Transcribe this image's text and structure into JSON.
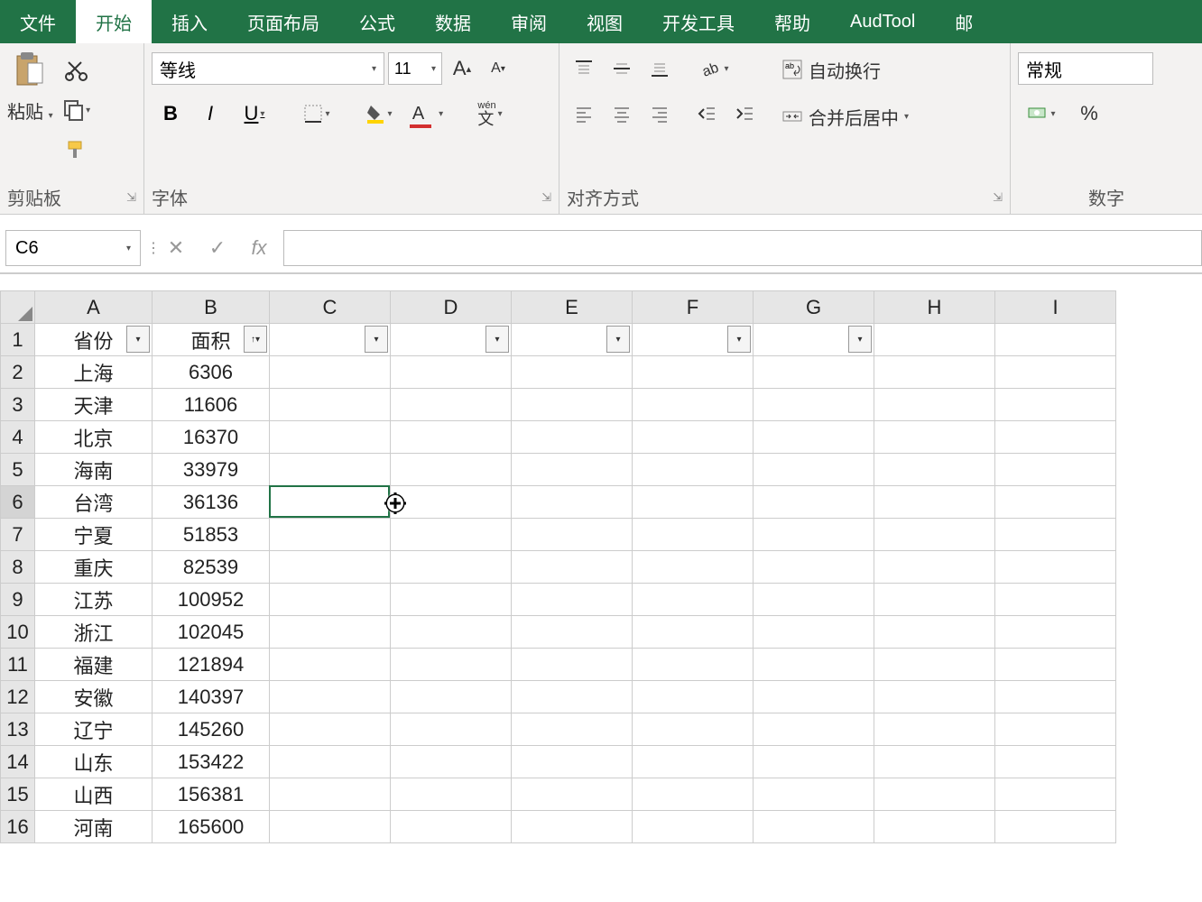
{
  "ribbon": {
    "tabs": [
      "文件",
      "开始",
      "插入",
      "页面布局",
      "公式",
      "数据",
      "审阅",
      "视图",
      "开发工具",
      "帮助",
      "AudTool",
      "邮"
    ],
    "active_tab_index": 1,
    "clipboard": {
      "paste_label": "粘贴",
      "group_label": "剪贴板"
    },
    "font": {
      "name": "等线",
      "size": "11",
      "group_label": "字体"
    },
    "alignment": {
      "wrap_label": "自动换行",
      "merge_label": "合并后居中",
      "group_label": "对齐方式"
    },
    "number": {
      "format": "常规",
      "group_label": "数字"
    }
  },
  "formula_bar": {
    "cell_ref": "C6",
    "fx_label": "fx",
    "formula_value": ""
  },
  "grid": {
    "columns": [
      "A",
      "B",
      "C",
      "D",
      "E",
      "F",
      "G",
      "H",
      "I"
    ],
    "header_row": {
      "A": "省份",
      "B": "面积"
    },
    "rows": [
      {
        "num": 1,
        "A": "省份",
        "B": "面积"
      },
      {
        "num": 2,
        "A": "上海",
        "B": "6306"
      },
      {
        "num": 3,
        "A": "天津",
        "B": "11606"
      },
      {
        "num": 4,
        "A": "北京",
        "B": "16370"
      },
      {
        "num": 5,
        "A": "海南",
        "B": "33979"
      },
      {
        "num": 6,
        "A": "台湾",
        "B": "36136"
      },
      {
        "num": 7,
        "A": "宁夏",
        "B": "51853"
      },
      {
        "num": 8,
        "A": "重庆",
        "B": "82539"
      },
      {
        "num": 9,
        "A": "江苏",
        "B": "100952"
      },
      {
        "num": 10,
        "A": "浙江",
        "B": "102045"
      },
      {
        "num": 11,
        "A": "福建",
        "B": "121894"
      },
      {
        "num": 12,
        "A": "安徽",
        "B": "140397"
      },
      {
        "num": 13,
        "A": "辽宁",
        "B": "145260"
      },
      {
        "num": 14,
        "A": "山东",
        "B": "153422"
      },
      {
        "num": 15,
        "A": "山西",
        "B": "156381"
      },
      {
        "num": 16,
        "A": "河南",
        "B": "165600"
      }
    ],
    "selected_cell": "C6",
    "active_row": 6,
    "filter_columns": [
      "A",
      "B",
      "C",
      "D",
      "E",
      "F",
      "G"
    ],
    "sorted_asc_column": "B"
  }
}
